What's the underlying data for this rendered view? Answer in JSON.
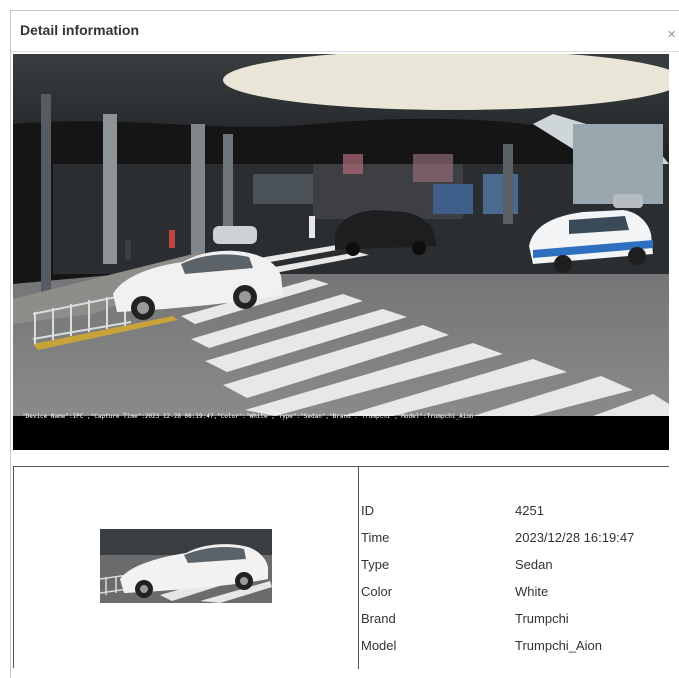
{
  "dialog": {
    "title": "Detail information",
    "close_icon": "close-icon"
  },
  "capture": {
    "caption": "\"Device Name\":IPC ,\"Capture Time\":2023 12-28 08:19:47,\"Color\":\"White\",\"Type\":\"Sedan\",\"Brand\":\"Trumpchi\",\"Model\":Trumpchi_Aion"
  },
  "details": {
    "rows": [
      {
        "label": "ID",
        "value": "4251"
      },
      {
        "label": "Time",
        "value": "2023/12/28 16:19:47"
      },
      {
        "label": "Type",
        "value": "Sedan"
      },
      {
        "label": "Color",
        "value": "White"
      },
      {
        "label": "Brand",
        "value": "Trumpchi"
      },
      {
        "label": "Model",
        "value": "Trumpchi_Aion"
      }
    ]
  }
}
